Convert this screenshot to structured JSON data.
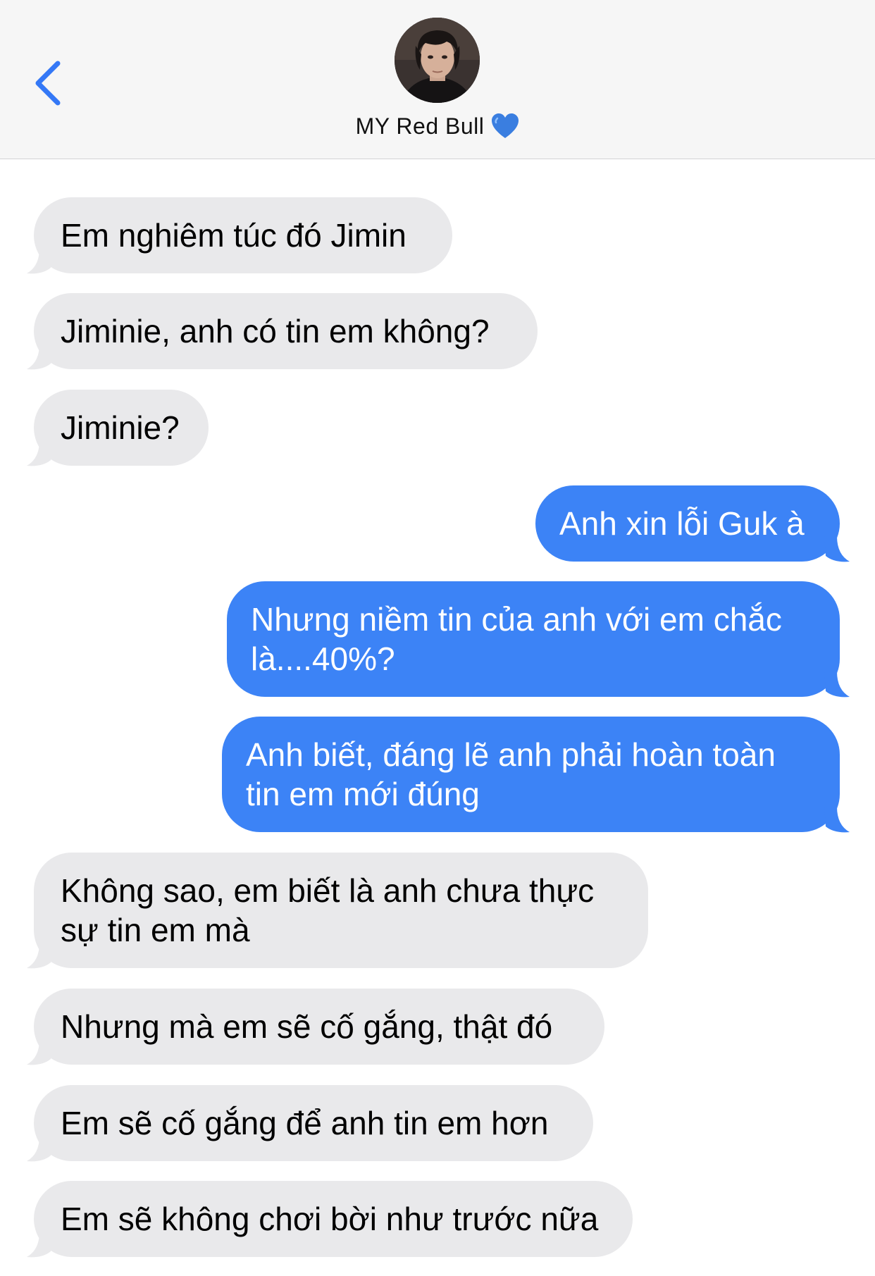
{
  "header": {
    "back_icon": "chevron-left-icon",
    "contact_name": "MY Red Bull",
    "name_emoji": "blue-heart-icon",
    "accent_color": "#3478f6"
  },
  "colors": {
    "incoming_bubble": "#e9e9eb",
    "outgoing_bubble": "#3c83f6",
    "header_background": "#f6f6f6"
  },
  "messages": [
    {
      "direction": "incoming",
      "lines": [
        "Em nghiêm túc đó Jimin"
      ]
    },
    {
      "direction": "incoming",
      "lines": [
        "Jiminie, anh có tin em không?"
      ]
    },
    {
      "direction": "incoming",
      "lines": [
        "Jiminie?"
      ]
    },
    {
      "direction": "outgoing",
      "lines": [
        "Anh xin lỗi Guk à"
      ]
    },
    {
      "direction": "outgoing",
      "lines": [
        "Nhưng niềm tin của anh với em chắc",
        "là....40%?"
      ]
    },
    {
      "direction": "outgoing",
      "lines": [
        "Anh biết, đáng lẽ anh phải hoàn toàn",
        "tin em mới đúng"
      ]
    },
    {
      "direction": "incoming",
      "lines": [
        "Không sao, em biết là anh chưa thực",
        "sự tin em mà"
      ]
    },
    {
      "direction": "incoming",
      "lines": [
        "Nhưng mà em sẽ cố gắng, thật đó"
      ]
    },
    {
      "direction": "incoming",
      "lines": [
        "Em sẽ cố gắng để anh tin em hơn"
      ]
    },
    {
      "direction": "incoming",
      "lines": [
        "Em sẽ không chơi bời như trước nữa"
      ]
    }
  ]
}
